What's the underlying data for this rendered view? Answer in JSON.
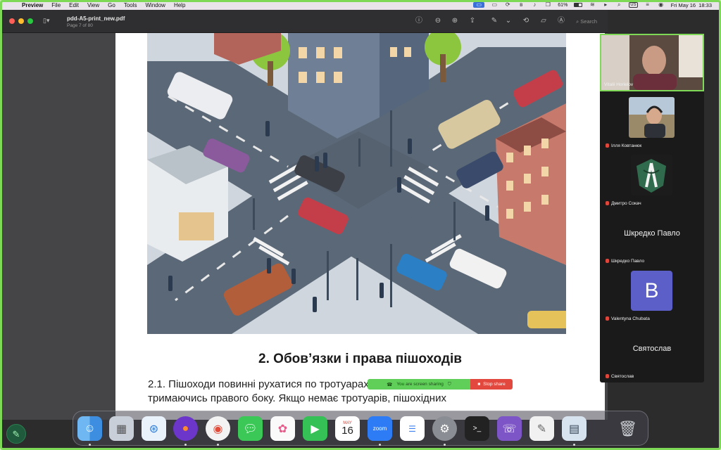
{
  "menubar": {
    "app_name": "Preview",
    "menus": [
      "File",
      "Edit",
      "View",
      "Go",
      "Tools",
      "Window",
      "Help"
    ],
    "battery": "61%",
    "keyboard": "US",
    "clock": "Fri May 16  18:33"
  },
  "preview": {
    "doc_title": "pdd-A5-print_new.pdf",
    "page_indicator": "Page 7 of 80",
    "search_placeholder": "Search",
    "section_heading": "2. Обов’язки і права пішоходів",
    "paragraph_line1": "2.1. Пішоходи повинні рухатися по тротуарах і пішохідних доріжках,",
    "paragraph_line2": "тримаючись правого боку. Якщо немає тротуарів, пішохідних"
  },
  "share": {
    "status_text": "You are screen sharing",
    "stop_label": "Stop share"
  },
  "participants": [
    {
      "name": "Vitalii Horielov",
      "display": "video"
    },
    {
      "name": "Ілля Ковтанюк",
      "display": "video"
    },
    {
      "name": "Дмитро Сокач",
      "display": "video"
    },
    {
      "name": "Шкредко Павло",
      "display": "name",
      "big_name": "Шкредко Павло"
    },
    {
      "name": "Valentyna Chubata",
      "display": "avatar",
      "avatar_letter": "B"
    },
    {
      "name": "Святослав",
      "display": "name",
      "big_name": "Святослав"
    }
  ],
  "dock": {
    "calendar_month": "MAY",
    "calendar_day": "16",
    "zoom_label": "zoom",
    "apps": [
      "Finder",
      "Launchpad",
      "Safari",
      "Firefox",
      "Chrome",
      "Messages",
      "Photos",
      "FaceTime",
      "Calendar",
      "Zoom",
      "Reminders",
      "System Settings",
      "Terminal",
      "Viber",
      "TextEdit",
      "Preview",
      "Trash"
    ]
  },
  "colors": {
    "share_border": "#7ed957",
    "share_green": "#5fcf5a",
    "stop_red": "#e2483d",
    "avatar_purple": "#5b5fc7"
  }
}
